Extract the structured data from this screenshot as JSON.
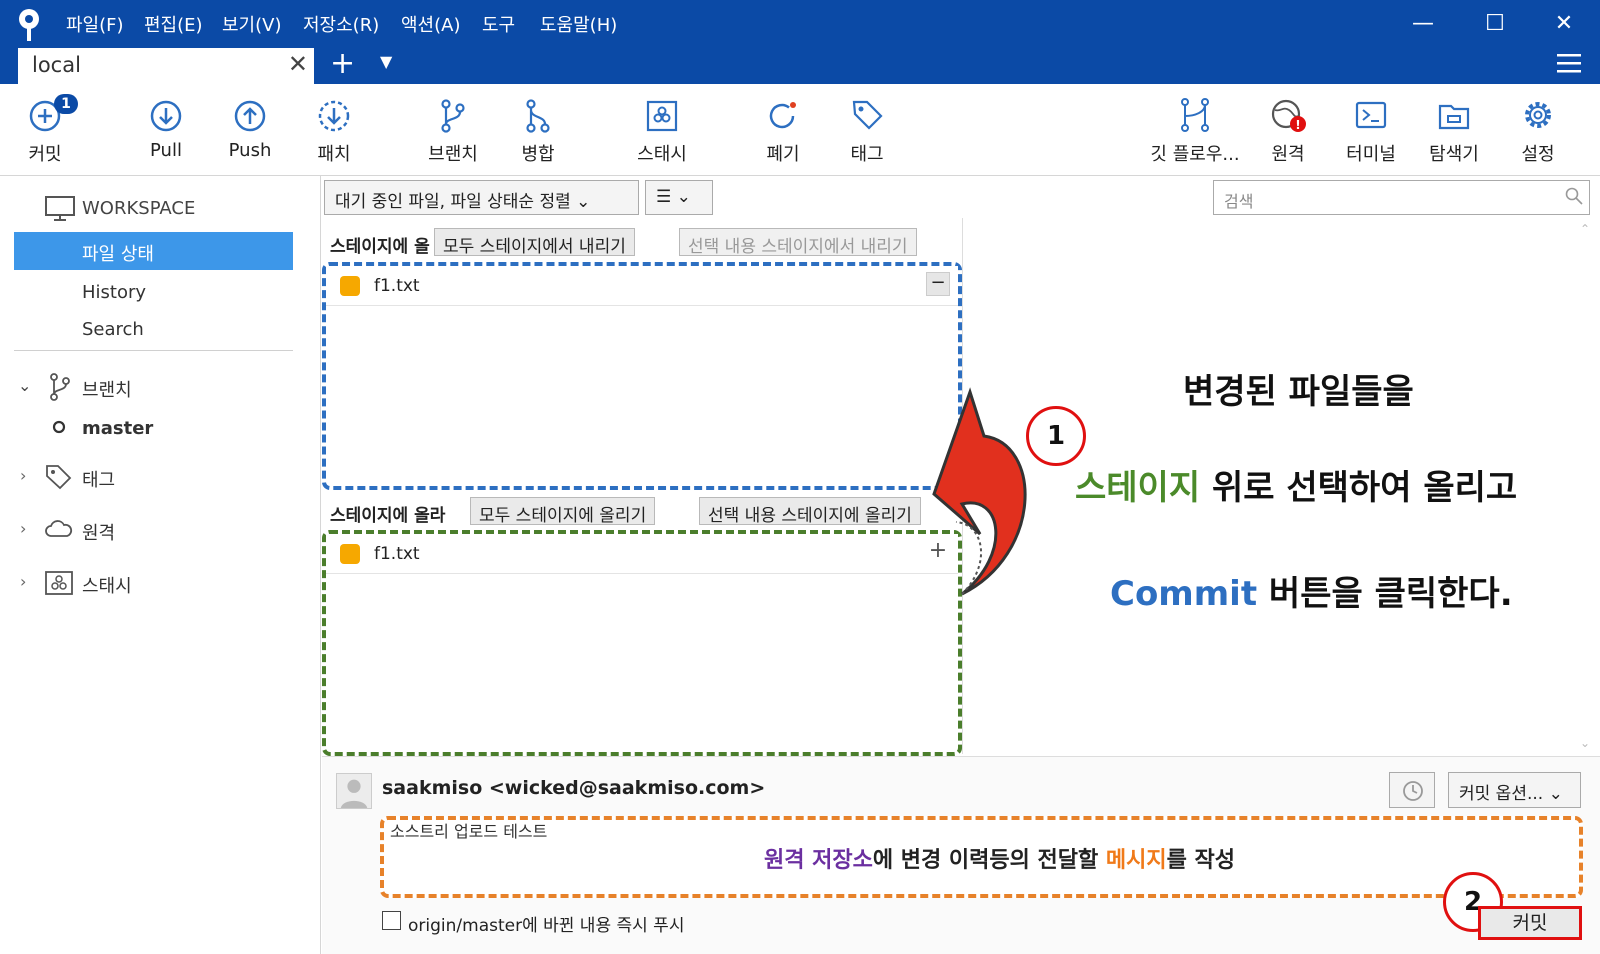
{
  "menu": [
    "파일(F)",
    "편집(E)",
    "보기(V)",
    "저장소(R)",
    "액션(A)",
    "도구",
    "도움말(H)"
  ],
  "tab": {
    "label": "local"
  },
  "toolbar": {
    "commit": "커밋",
    "commit_badge": "1",
    "pull": "Pull",
    "push": "Push",
    "patch": "패치",
    "branch": "브랜치",
    "merge": "병합",
    "stash": "스태시",
    "discard": "폐기",
    "tag": "태그",
    "gitflow": "깃 플로우...",
    "remote": "원격",
    "terminal": "터미널",
    "explorer": "탐색기",
    "settings": "설정"
  },
  "sidebar": {
    "workspace": "WORKSPACE",
    "file_status": "파일 상태",
    "history": "History",
    "search": "Search",
    "branches": "브랜치",
    "master": "master",
    "tags": "태그",
    "remotes": "원격",
    "stashes": "스태시"
  },
  "filters": {
    "sort": "대기 중인 파일, 파일 상태순 정렬",
    "search_placeholder": "검색"
  },
  "staged": {
    "header": "스테이지에 올",
    "unstage_all": "모두 스테이지에서 내리기",
    "unstage_sel": "선택 내용 스테이지에서 내리기",
    "files": [
      "f1.txt"
    ]
  },
  "unstaged": {
    "header": "스테이지에 올라",
    "stage_all": "모두 스테이지에 올리기",
    "stage_sel": "선택 내용 스테이지에 올리기",
    "files": [
      "f1.txt"
    ]
  },
  "annotation": {
    "line1": "변경된 파일들을",
    "line2a": "스테이지",
    "line2b": " 위로 선택하여 올리고",
    "line3a": "Commit",
    "line3b": " 버튼을 클릭한다.",
    "step1": "1",
    "step2": "2",
    "msg_a": "원격 저장소",
    "msg_b": "에 변경 이력등의 전달할 ",
    "msg_c": "메시지",
    "msg_d": "를 작성"
  },
  "commit": {
    "author": "saakmiso <wicked@saakmiso.com>",
    "options": "커밋 옵션...",
    "message": "소스트리 업로드 테스트",
    "push_label": "origin/master에 바뀐 내용 즉시 푸시",
    "button": "커밋"
  },
  "colors": {
    "titlebar": "#0b4aa6",
    "selection": "#3d97e9",
    "green_text": "#4b8a2a",
    "blue_text": "#2d6fc1",
    "purple_text": "#6b2fa0",
    "orange_text": "#f07a1a"
  }
}
